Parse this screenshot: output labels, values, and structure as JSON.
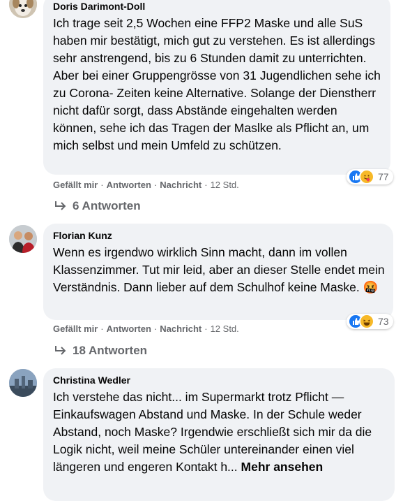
{
  "comments": [
    {
      "author": "Doris Darimont-Doll",
      "text": "Ich trage seit 2,5 Wochen eine FFP2 Maske und alle SuS haben mir bestätigt, mich gut zu verstehen. Es ist allerdings sehr anstrengend, bis zu 6 Stunden damit zu unterrichten. Aber bei einer Gruppengrösse von 31 Jugendlichen sehe ich zu Corona- Zeiten keine Alternative. Solange der Dienstherr nicht dafür sorgt, dass Abstände eingehalten werden können, sehe ich das Tragen der Maslke als Pflicht an, um mich selbst und mein Umfeld zu schützen.",
      "actions": {
        "like": "Gefällt mir",
        "reply": "Antworten",
        "message": "Nachricht",
        "time": "12 Std."
      },
      "reactions": {
        "icons": [
          "like-icon",
          "care-icon"
        ],
        "count": "77"
      },
      "replies": "6 Antworten"
    },
    {
      "author": "Florian Kunz",
      "text": "Wenn es irgendwo wirklich Sinn macht, dann im vollen Klassenzimmer. Tut mir leid, aber an dieser Stelle endet mein Verständnis. Dann lieber auf dem Schulhof keine Maske. 🤬",
      "actions": {
        "like": "Gefällt mir",
        "reply": "Antworten",
        "message": "Nachricht",
        "time": "12 Std."
      },
      "reactions": {
        "icons": [
          "like-icon",
          "haha-icon"
        ],
        "count": "73"
      },
      "replies": "18 Antworten"
    },
    {
      "author": "Christina Wedler",
      "text": "Ich verstehe das nicht... im Supermarkt trotz Pflicht —Einkaufswagen Abstand und Maske. In der Schule weder Abstand, noch Maske? Irgendwie erschließt sich mir da die Logik nicht, weil meine Schüler untereinander einen viel längeren und engeren Kontakt h...",
      "more": "Mehr ansehen"
    }
  ],
  "colors": {
    "bubble": "#f0f2f5",
    "meta": "#65676b",
    "like": "#1877f2",
    "emoji": "#f7b928"
  }
}
